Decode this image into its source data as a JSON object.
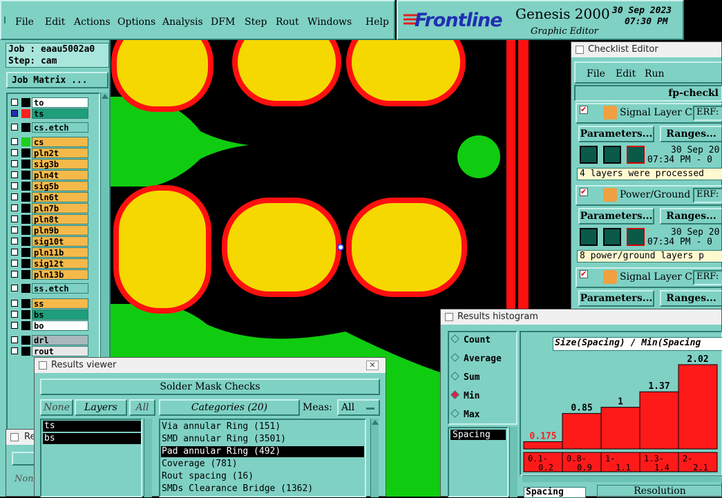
{
  "menubar": {
    "items": [
      "File",
      "Edit",
      "Actions",
      "Options",
      "Analysis",
      "DFM",
      "Step",
      "Rout",
      "Windows",
      "Help"
    ]
  },
  "brand": {
    "logo": "Frontline",
    "product": "Genesis 2000",
    "subtitle": "Graphic Editor",
    "date": "30 Sep 2023",
    "time": "07:30 PM"
  },
  "job": {
    "job_label": "Job : eaau5002a0",
    "step_label": "Step: cam",
    "matrix_button": "Job Matrix ..."
  },
  "layers": [
    {
      "name": "to",
      "bg": "#ffffff",
      "swatch": "#000000"
    },
    {
      "name": "ts",
      "bg": "#1e9e7a",
      "swatch": "#ff2020"
    },
    {
      "name": "cs.etch",
      "bg": "#7fd1c4",
      "swatch": "#000000"
    },
    {
      "name": "cs",
      "bg": "#f5b94a",
      "swatch": "#20cc20"
    },
    {
      "name": "pln2t",
      "bg": "#f5b94a",
      "swatch": "#000000"
    },
    {
      "name": "sig3b",
      "bg": "#f5b94a",
      "swatch": "#000000"
    },
    {
      "name": "pln4t",
      "bg": "#f5b94a",
      "swatch": "#000000"
    },
    {
      "name": "sig5b",
      "bg": "#f5b94a",
      "swatch": "#000000"
    },
    {
      "name": "pln6t",
      "bg": "#f5b94a",
      "swatch": "#000000"
    },
    {
      "name": "pln7b",
      "bg": "#f5b94a",
      "swatch": "#000000"
    },
    {
      "name": "pln8t",
      "bg": "#f5b94a",
      "swatch": "#000000"
    },
    {
      "name": "pln9b",
      "bg": "#f5b94a",
      "swatch": "#000000"
    },
    {
      "name": "sig10t",
      "bg": "#f5b94a",
      "swatch": "#000000"
    },
    {
      "name": "pln11b",
      "bg": "#f5b94a",
      "swatch": "#000000"
    },
    {
      "name": "sig12t",
      "bg": "#f5b94a",
      "swatch": "#000000"
    },
    {
      "name": "pln13b",
      "bg": "#f5b94a",
      "swatch": "#000000"
    },
    {
      "name": "ss.etch",
      "bg": "#7fd1c4",
      "swatch": "#000000"
    },
    {
      "name": "ss",
      "bg": "#f5b94a",
      "swatch": "#000000"
    },
    {
      "name": "bs",
      "bg": "#1e9e7a",
      "swatch": "#000000"
    },
    {
      "name": "bo",
      "bg": "#ffffff",
      "swatch": "#000000"
    },
    {
      "name": "drl",
      "bg": "#a8b8bc",
      "swatch": "#000000"
    },
    {
      "name": "rout",
      "bg": "#e8e8e8",
      "swatch": "#000000"
    }
  ],
  "checklist": {
    "title": "Checklist Editor",
    "menu": [
      "File",
      "Edit",
      "Run"
    ],
    "name": "fp-checkl",
    "items": [
      {
        "title": "Signal Layer Ch",
        "erf": "ERF:",
        "params": "Parameters...",
        "ranges": "Ranges...",
        "date": "30 Sep 20",
        "time": "07:34 PM - 0",
        "status": "4 layers were processed"
      },
      {
        "title": "Power/Ground C",
        "erf": "ERF:",
        "params": "Parameters...",
        "ranges": "Ranges...",
        "date": "30 Sep 20",
        "time": "07:34 PM - 0",
        "status": "8 power/ground layers p"
      },
      {
        "title": "Signal Layer Ch",
        "erf": "ERF:",
        "params": "Parameters...",
        "ranges": "Ranges..."
      }
    ]
  },
  "histogram": {
    "title": "Results histogram",
    "modes": [
      "Count",
      "Average",
      "Sum",
      "Min",
      "Max"
    ],
    "selected_mode": "Min",
    "list_item": "Spacing",
    "bottom_label": "Spacing",
    "resolution_label": "Resolution",
    "chart_title": "Size(Spacing) / Min(Spacing"
  },
  "chart_data": {
    "type": "bar",
    "title": "Size(Spacing) / Min(Spacing",
    "categories": [
      "0.1-\n0.2",
      "0.8-\n0.9",
      "1-\n1.1",
      "1.3-\n1.4",
      "2-\n2.1"
    ],
    "category_lines": [
      [
        "0.1-",
        "0.2"
      ],
      [
        "0.8-",
        "0.9"
      ],
      [
        "1-",
        "1.1"
      ],
      [
        "1.3-",
        "1.4"
      ],
      [
        "2-",
        "2.1"
      ]
    ],
    "values": [
      0.175,
      0.85,
      1,
      1.37,
      2.02
    ],
    "value_labels": [
      "0.175",
      "0.85",
      "1",
      "1.37",
      "2.02"
    ],
    "ylim": [
      0,
      2.3
    ],
    "colors": {
      "bar": "#ff1a1a",
      "first_label": "#ff1a1a",
      "label": "#000000"
    }
  },
  "results": {
    "title": "Results viewer",
    "heading": "Solder Mask Checks",
    "none_label": "None",
    "layers_label": "Layers",
    "all_label": "All",
    "categories_label": "Categories (20)",
    "meas_label": "Meas:",
    "meas_value": "All",
    "layer_list": [
      "ts",
      "bs"
    ],
    "categories": [
      "Via annular Ring (151)",
      "SMD annular Ring (3501)",
      "Pad annular Ring (492)",
      "Coverage (781)",
      "Rout spacing (16)",
      "SMDs Clearance Bridge (1362)"
    ],
    "selected_category": "Pad annular Ring (492)"
  },
  "small_window": {
    "title": "Re",
    "none_label": "Non"
  },
  "colors": {
    "canvas": "#000000",
    "pad_fill": "#f5d800",
    "pad_ring": "#ff1010",
    "copper": "#10cc10",
    "ui": "#7fd1c4"
  }
}
